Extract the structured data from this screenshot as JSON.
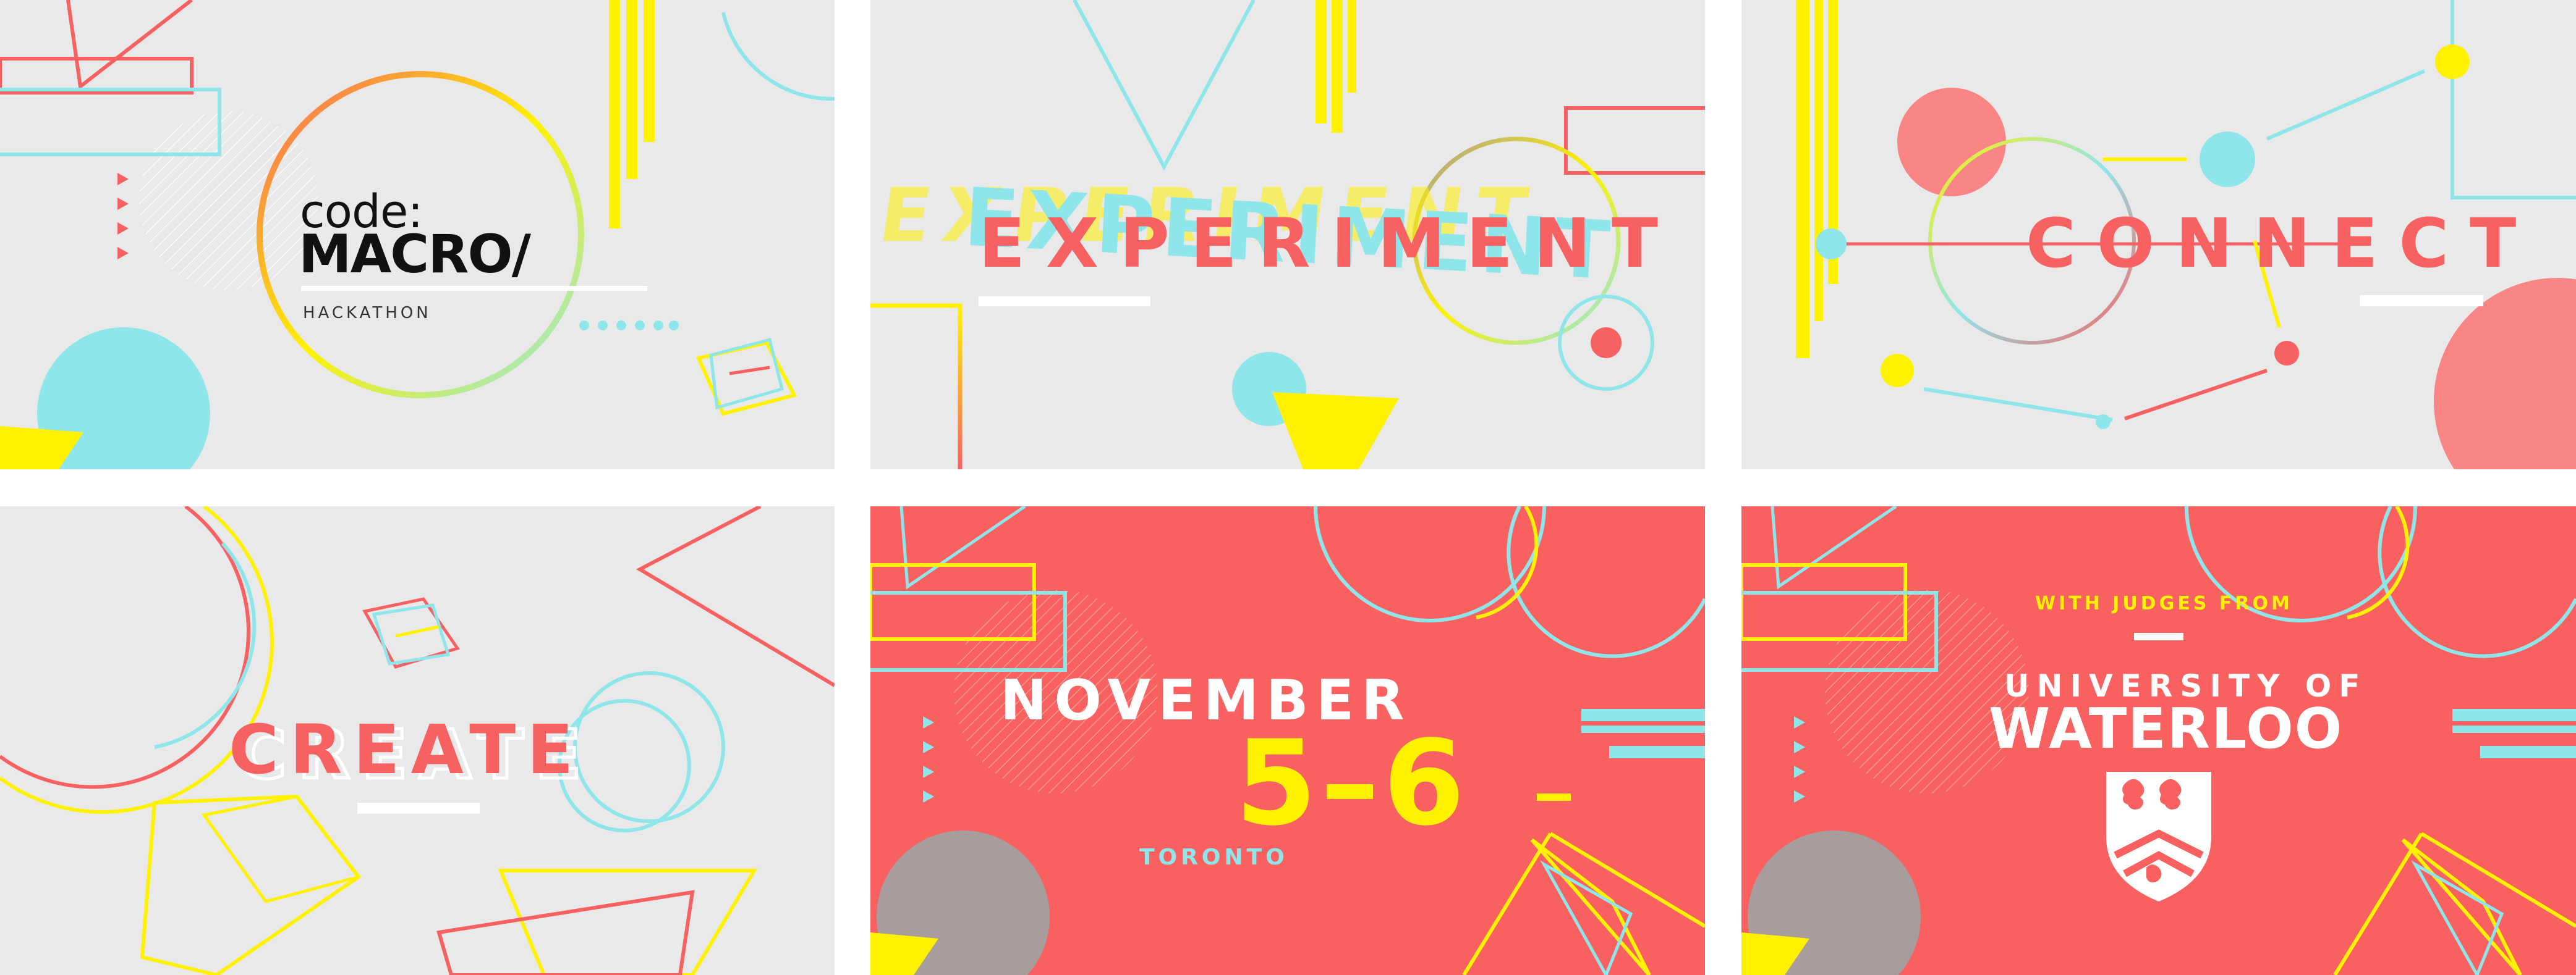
{
  "colors": {
    "panel_gray": "#e9e9e9",
    "panel_red": "#f96161",
    "coral": "#f86161",
    "cyan": "#8fe6ea",
    "yellow": "#fff200",
    "white": "#ffffff",
    "black": "#111111",
    "mauve": "#a89c9c"
  },
  "panels": [
    {
      "logo": {
        "prefix": "code:",
        "title": "MACRO/",
        "subtitle": "HACKATHON"
      }
    },
    {
      "word": "EXPERIMENT"
    },
    {
      "word": "CONNECT"
    },
    {
      "word": "CREATE"
    },
    {
      "month": "NOVEMBER",
      "days": "5–6",
      "city": "TORONTO"
    },
    {
      "intro": "WITH JUDGES FROM",
      "university_line1": "UNIVERSITY OF",
      "university_line2": "WATERLOO",
      "crest": "university-crest-icon"
    }
  ]
}
